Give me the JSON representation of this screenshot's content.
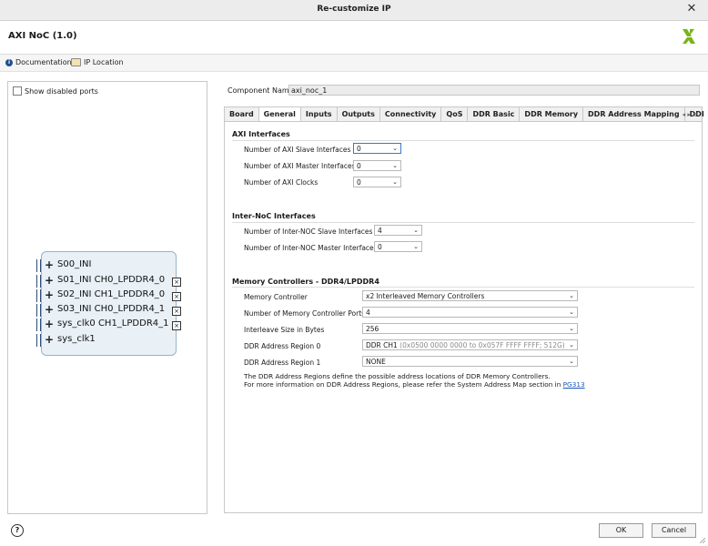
{
  "window": {
    "title": "Re-customize IP",
    "close_glyph": "✕"
  },
  "header": {
    "ip_name": "AXI NoC (1.0)"
  },
  "links": {
    "documentation": "Documentation",
    "ip_location": "IP Location"
  },
  "left_panel": {
    "show_disabled_ports": "Show disabled ports",
    "ports": [
      {
        "label": "S00_INI",
        "has_output": false
      },
      {
        "label": "S01_INI CH0_LPDDR4_0",
        "has_output": true
      },
      {
        "label": "S02_INI CH1_LPDDR4_0",
        "has_output": true
      },
      {
        "label": "S03_INI CH0_LPDDR4_1",
        "has_output": true
      },
      {
        "label": "sys_clk0 CH1_LPDDR4_1",
        "has_output": true
      },
      {
        "label": "sys_clk1",
        "has_output": false
      }
    ]
  },
  "component": {
    "label": "Component Name",
    "value": "axi_noc_1"
  },
  "tabs": [
    "Board",
    "General",
    "Inputs",
    "Outputs",
    "Connectivity",
    "QoS",
    "DDR Basic",
    "DDR Memory",
    "DDR Address Mapping",
    "DDI"
  ],
  "active_tab": "General",
  "tab_nav": "◂ ▸ ≡",
  "axi_interfaces": {
    "title": "AXI Interfaces",
    "fields": [
      {
        "label": "Number of AXI Slave Interfaces",
        "value": "0"
      },
      {
        "label": "Number of AXI Master Interfaces",
        "value": "0"
      },
      {
        "label": "Number of AXI Clocks",
        "value": "0"
      }
    ]
  },
  "inter_noc": {
    "title": "Inter-NoC Interfaces",
    "fields": [
      {
        "label": "Number of Inter-NOC Slave Interfaces",
        "value": "4"
      },
      {
        "label": "Number of Inter-NOC Master Interfaces",
        "value": "0"
      }
    ]
  },
  "memory_controllers": {
    "title": "Memory Controllers - DDR4/LPDDR4",
    "fields": [
      {
        "label": "Memory Controller",
        "value": "x2 Interleaved Memory Controllers"
      },
      {
        "label": "Number of Memory Controller Ports",
        "value": "4"
      },
      {
        "label": "Interleave Size in Bytes",
        "value": "256"
      },
      {
        "label": "DDR Address Region 0",
        "value": "DDR CH1",
        "value_detail": " (0x0500 0000 0000 to 0x057F FFFF FFFF; 512G)"
      },
      {
        "label": "DDR Address Region 1",
        "value": "NONE"
      }
    ],
    "note_line1": "The DDR Address Regions define the possible address locations of DDR Memory Controllers.",
    "note_line2": "For more information on DDR Address Regions, please refer the System Address Map section in ",
    "note_link": "PG313"
  },
  "footer": {
    "help": "?",
    "ok": "OK",
    "cancel": "Cancel"
  },
  "colors": {
    "accent": "#3b78c4",
    "logo_green": "#7ab317",
    "link": "#1a56b8"
  }
}
